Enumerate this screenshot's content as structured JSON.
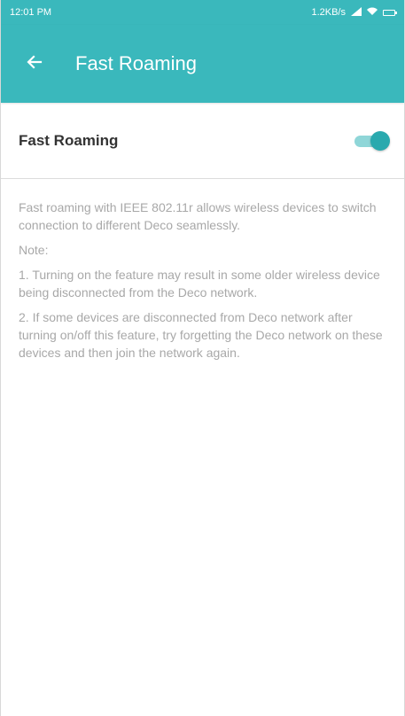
{
  "status_bar": {
    "time": "12:01 PM",
    "speed": "1.2KB/s"
  },
  "app_bar": {
    "title": "Fast Roaming"
  },
  "setting": {
    "label": "Fast Roaming",
    "enabled": true
  },
  "description": {
    "intro": "Fast roaming with IEEE 802.11r allows wireless devices to switch connection to different Deco seamlessly.",
    "note_heading": "Note:",
    "note_1": "1. Turning on the feature may result in some older wireless device being disconnected from the Deco network.",
    "note_2": "2. If some devices are disconnected from Deco network after turning on/off this feature, try forgetting the Deco network on these devices and then join the network again."
  },
  "colors": {
    "primary": "#3ab8bc",
    "toggle_on": "#2aa9ae",
    "text_muted": "#a8a8a8"
  },
  "icons": {
    "back": "arrow-left-icon",
    "signal": "signal-icon",
    "wifi": "wifi-icon",
    "battery": "battery-icon"
  }
}
